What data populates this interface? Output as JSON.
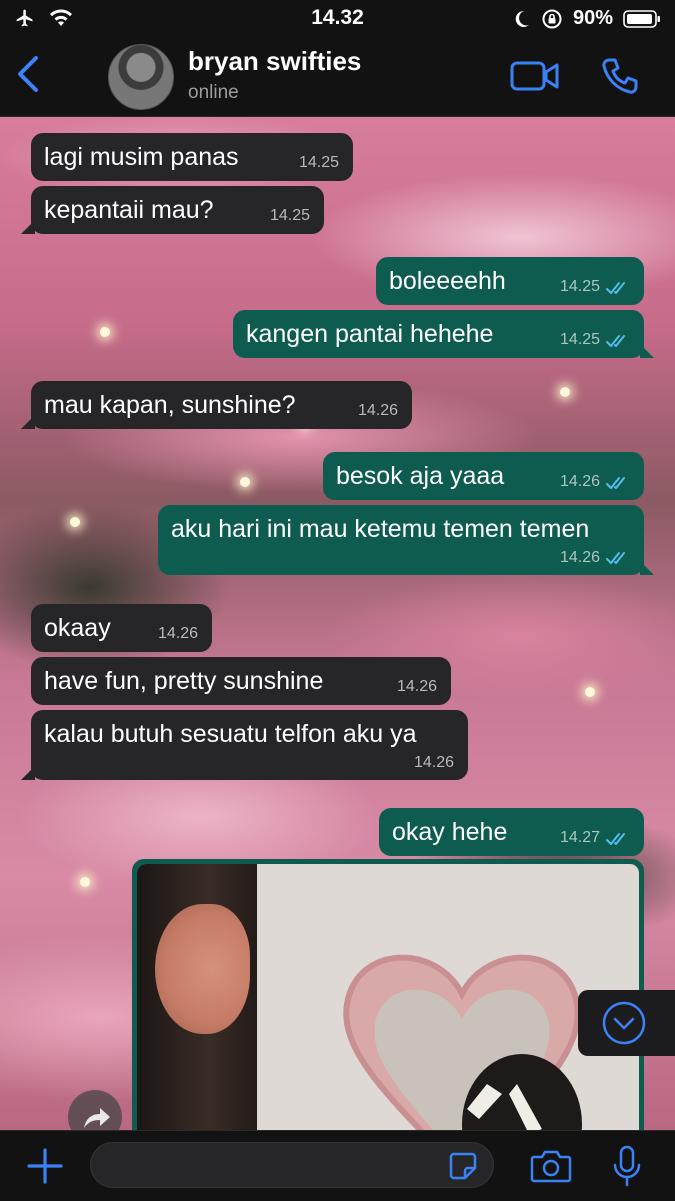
{
  "status_bar": {
    "time": "14.32",
    "battery": "90%"
  },
  "header": {
    "contact_name": "bryan swifties",
    "contact_status": "online"
  },
  "messages": [
    {
      "dir": "in",
      "text": "lagi musim panas",
      "time": "14.25"
    },
    {
      "dir": "in",
      "text": "kepantaii mau?",
      "time": "14.25"
    },
    {
      "dir": "out",
      "text": "boleeeehh",
      "time": "14.25"
    },
    {
      "dir": "out",
      "text": "kangen pantai hehehe",
      "time": "14.25"
    },
    {
      "dir": "in",
      "text": "mau kapan, sunshine?",
      "time": "14.26"
    },
    {
      "dir": "out",
      "text": "besok aja yaaa",
      "time": "14.26"
    },
    {
      "dir": "out",
      "text": "aku hari ini mau ketemu temen temen",
      "time": "14.26"
    },
    {
      "dir": "in",
      "text": "okaay",
      "time": "14.26"
    },
    {
      "dir": "in",
      "text": "have fun, pretty sunshine",
      "time": "14.26"
    },
    {
      "dir": "in",
      "text": "kalau butuh sesuatu telfon aku ya",
      "time": "14.26"
    },
    {
      "dir": "out",
      "text": "okay hehe",
      "time": "14.27"
    }
  ],
  "input": {
    "placeholder": ""
  },
  "colors": {
    "accent": "#3b82f6",
    "incoming_bubble": "#262628",
    "outgoing_bubble": "#0e5c4f",
    "read_ticks": "#53bdeb"
  }
}
